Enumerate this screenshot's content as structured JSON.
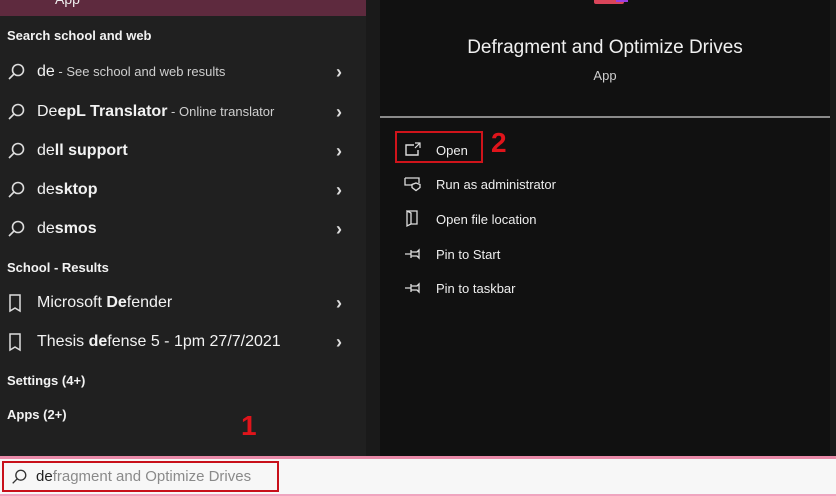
{
  "top_result": {
    "type": "App"
  },
  "left": {
    "section_web": "Search school and web",
    "web_items": [
      {
        "pre": "de",
        "bold": "",
        "post": "",
        "sub": " - See school and web results"
      },
      {
        "pre": "De",
        "bold": "epL Translator",
        "post": "",
        "sub": " - Online translator"
      },
      {
        "pre": "de",
        "bold": "ll support",
        "post": "",
        "sub": ""
      },
      {
        "pre": "de",
        "bold": "sktop",
        "post": "",
        "sub": ""
      },
      {
        "pre": "de",
        "bold": "smos",
        "post": "",
        "sub": ""
      }
    ],
    "section_school": "School - Results",
    "school_items": [
      {
        "pre": "Microsoft ",
        "bold": "De",
        "post": "fender"
      },
      {
        "pre": "Thesis ",
        "bold": "de",
        "post": "fense 5 - 1pm 27/7/2021"
      }
    ],
    "settings": "Settings (4+)",
    "apps": "Apps (2+)"
  },
  "preview": {
    "title": "Defragment and Optimize Drives",
    "type": "App",
    "actions": [
      {
        "label": "Open",
        "icon": "open-icon"
      },
      {
        "label": "Run as administrator",
        "icon": "shield-icon"
      },
      {
        "label": "Open file location",
        "icon": "folder-icon"
      },
      {
        "label": "Pin to Start",
        "icon": "pin-icon"
      },
      {
        "label": "Pin to taskbar",
        "icon": "pin-icon"
      }
    ]
  },
  "annotations": {
    "step1": "1",
    "step2": "2"
  },
  "search": {
    "typed": "de",
    "completion": "fragment and Optimize Drives"
  },
  "colors": {
    "accent": "#5e2a3e",
    "highlight": "#d0141b"
  }
}
